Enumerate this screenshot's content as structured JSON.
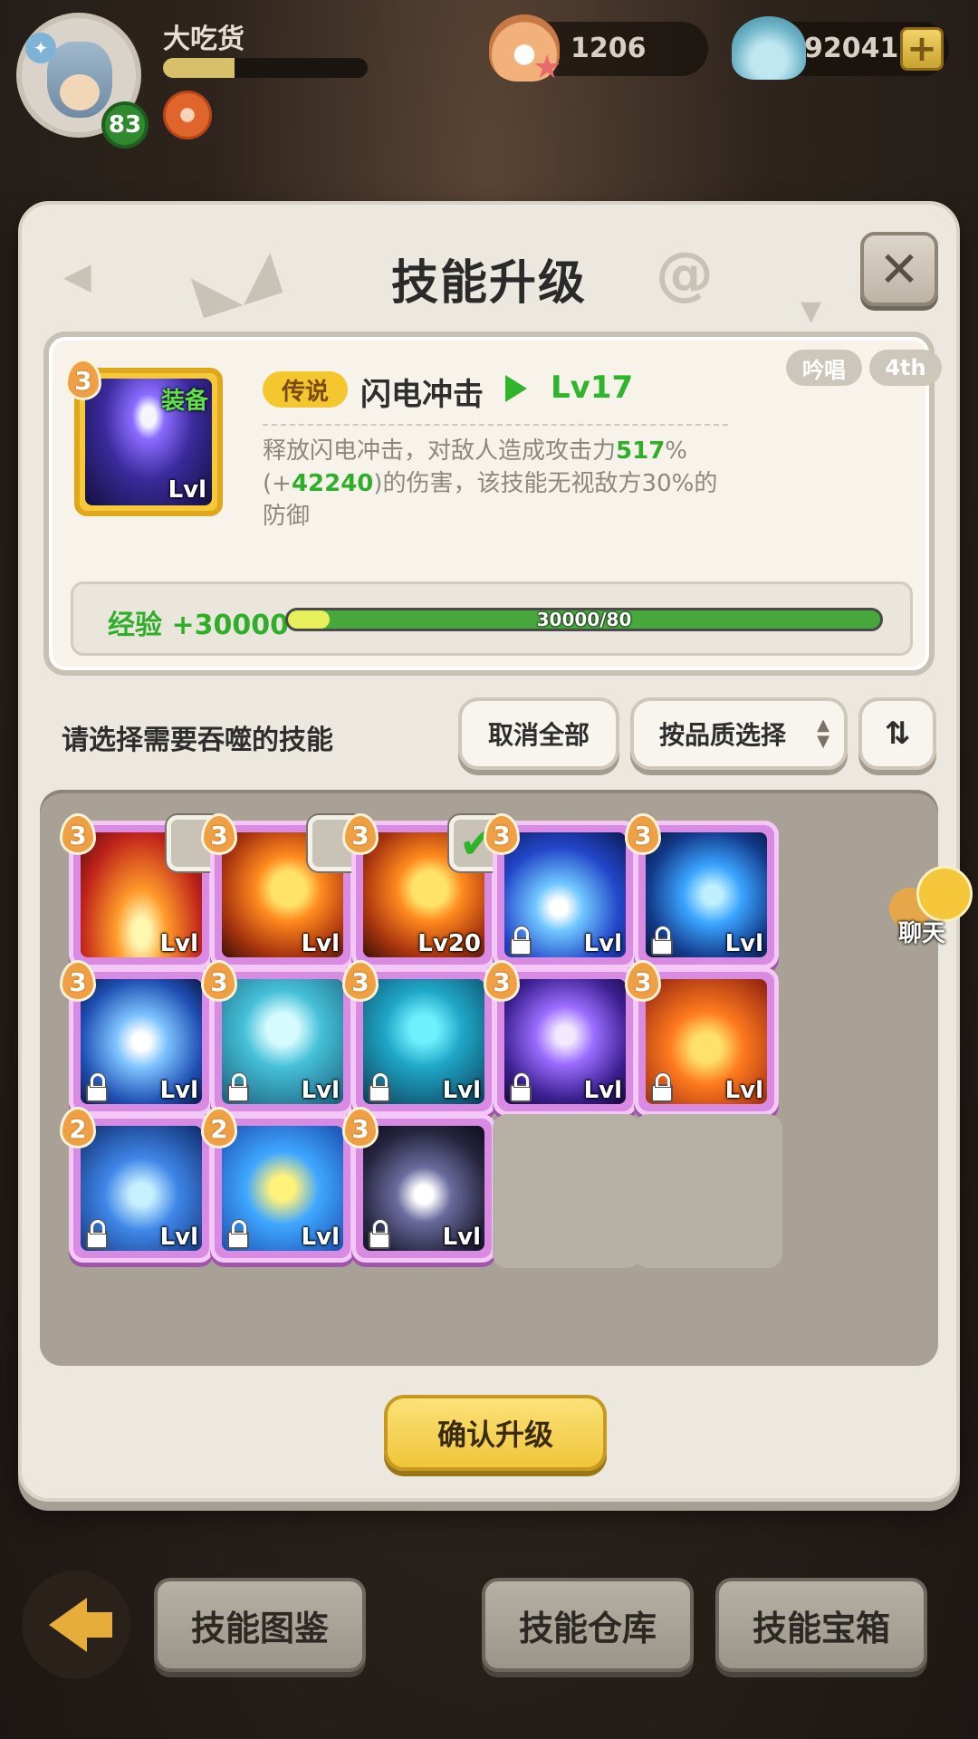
{
  "player": {
    "name": "大吃货",
    "level": "83"
  },
  "resources": {
    "pearl": "1206",
    "shell": "920417"
  },
  "panel": {
    "title": "技能升级",
    "close": "✕"
  },
  "skill": {
    "rank": "3",
    "equip_label": "装备",
    "icon_level": "Lvl",
    "rarity": "传说",
    "name": "闪电冲击",
    "level": "Lv17",
    "tag_type": "吟唱",
    "tag_order": "4th",
    "description": {
      "p1": "释放闪电冲击，对敌人造成攻击力",
      "v1": "517",
      "p2": "%(+",
      "v2": "42240",
      "p3": ")的伤害，该技能无视敌方30%的防御"
    }
  },
  "exp": {
    "label": "经验 +30000",
    "text": "30000/80",
    "progress": 0.07
  },
  "selection": {
    "label": "请选择需要吞噬的技能",
    "cancel_all": "取消全部",
    "by_quality": "按品质选择",
    "sort": "⇅"
  },
  "skills_grid": [
    {
      "rank": "3",
      "level": "Lvl",
      "locked": false,
      "checkbox": "empty",
      "art": "fire-burst"
    },
    {
      "rank": "3",
      "level": "Lvl",
      "locked": false,
      "checkbox": "empty",
      "art": "fireball"
    },
    {
      "rank": "3",
      "level": "Lv20",
      "locked": false,
      "checkbox": "checked",
      "art": "fireball"
    },
    {
      "rank": "3",
      "level": "Lvl",
      "locked": true,
      "checkbox": "none",
      "art": "ice-vortex"
    },
    {
      "rank": "3",
      "level": "Lvl",
      "locked": true,
      "checkbox": "none",
      "art": "blue-swirl"
    },
    {
      "rank": "3",
      "level": "Lvl",
      "locked": true,
      "checkbox": "none",
      "art": "wind-slash"
    },
    {
      "rank": "3",
      "level": "Lvl",
      "locked": true,
      "checkbox": "none",
      "art": "ice-spirit"
    },
    {
      "rank": "3",
      "level": "Lvl",
      "locked": true,
      "checkbox": "none",
      "art": "skull-cube"
    },
    {
      "rank": "3",
      "level": "Lvl",
      "locked": true,
      "checkbox": "none",
      "art": "thunder-cloud"
    },
    {
      "rank": "3",
      "level": "Lvl",
      "locked": true,
      "checkbox": "none",
      "art": "fire-spirit"
    },
    {
      "rank": "2",
      "level": "Lvl",
      "locked": true,
      "checkbox": "none",
      "art": "ice-arrow"
    },
    {
      "rank": "2",
      "level": "Lvl",
      "locked": true,
      "checkbox": "none",
      "art": "twin-spirits"
    },
    {
      "rank": "3",
      "level": "Lvl",
      "locked": true,
      "checkbox": "none",
      "art": "hex-star"
    }
  ],
  "confirm": "确认升级",
  "chat": "聊天",
  "bottom_nav": {
    "codex": "技能图鉴",
    "storage": "技能仓库",
    "chest": "技能宝箱"
  }
}
